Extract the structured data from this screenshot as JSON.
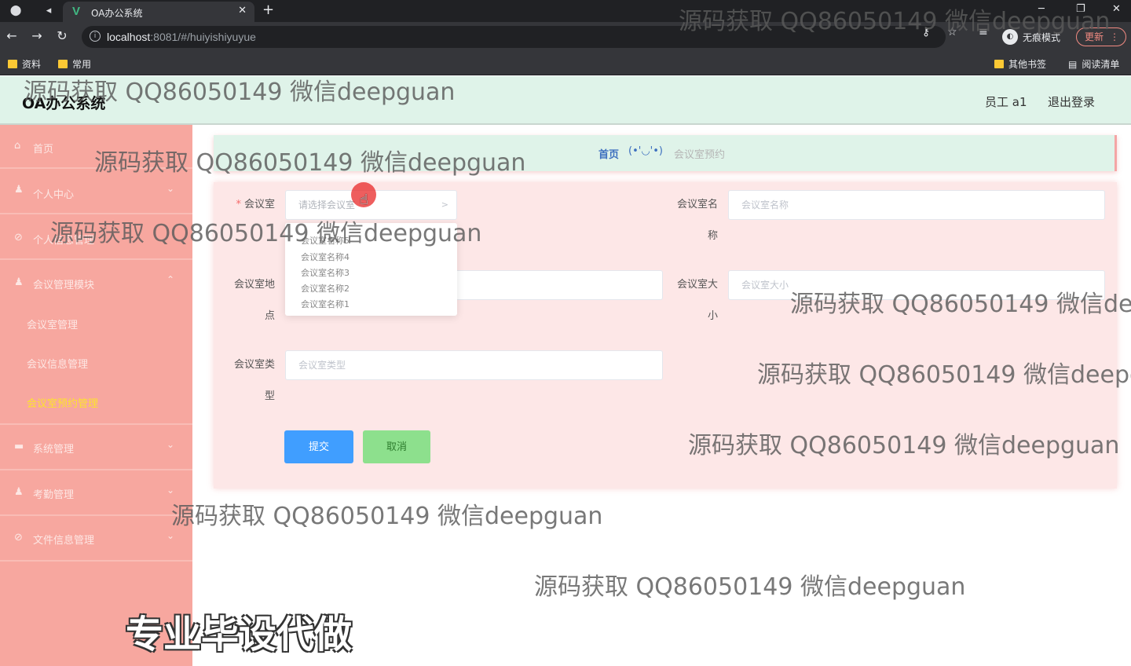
{
  "browser": {
    "tab_title": "OA办公系统",
    "url_host": "localhost",
    "url_rest": ":8081/#/huiyishiyuyue",
    "incognito_label": "无痕模式",
    "update_label": "更新",
    "bookmarks": [
      "资料",
      "常用"
    ],
    "bookmarks_right": [
      "其他书签",
      "阅读清单"
    ]
  },
  "header": {
    "title": "OA办公系统",
    "user": "员工 a1",
    "logout": "退出登录"
  },
  "sidebar": {
    "items": [
      {
        "label": "首页",
        "icon": "home-icon"
      },
      {
        "label": "个人中心",
        "icon": "user-icon"
      },
      {
        "label": "个人信息管理",
        "icon": "settings-icon"
      },
      {
        "label": "会议管理模块",
        "icon": "user-icon"
      },
      {
        "label": "系统管理",
        "icon": "message-icon"
      },
      {
        "label": "考勤管理",
        "icon": "user-icon"
      },
      {
        "label": "文件信息管理",
        "icon": "settings-icon"
      }
    ],
    "subitems": [
      "会议室管理",
      "会议信息管理",
      "会议室预约管理"
    ]
  },
  "breadcrumb": {
    "home": "首页",
    "face": "(•'◡'•)",
    "current": "会议室预约"
  },
  "form": {
    "room": {
      "label": "会议室",
      "placeholder": "请选择会议室"
    },
    "room_name": {
      "label1": "会议室名",
      "label2": "称",
      "placeholder": "会议室名称"
    },
    "room_location": {
      "label1": "会议室地",
      "label2": "点"
    },
    "room_size": {
      "label1": "会议室大",
      "label2": "小",
      "placeholder": "会议室大小"
    },
    "room_type": {
      "label1": "会议室类",
      "label2": "型",
      "placeholder": "会议室类型"
    },
    "dropdown_options": [
      "会议室名称5",
      "会议室名称4",
      "会议室名称3",
      "会议室名称2",
      "会议室名称1"
    ],
    "submit": "提交",
    "cancel": "取消"
  },
  "watermarks": {
    "text": "源码获取 QQ86050149 微信deepguan",
    "big": "专业毕设代做"
  }
}
